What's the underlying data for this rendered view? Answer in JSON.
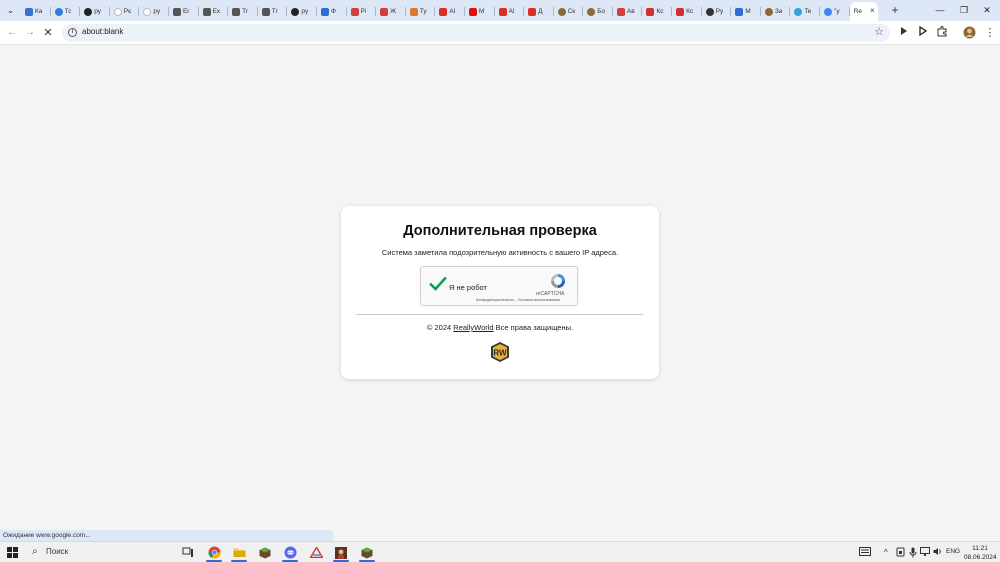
{
  "browser": {
    "tabs": [
      {
        "label": "Ка",
        "icon": "tab-favicon-blue-square",
        "color": "#3b6fd1"
      },
      {
        "label": "Тс",
        "icon": "tab-favicon-blue-circle",
        "color": "#2f7de1"
      },
      {
        "label": "py",
        "icon": "github-icon",
        "color": "#222222"
      },
      {
        "label": "Рє",
        "icon": "tab-favicon-white-circle",
        "color": "#ffffff"
      },
      {
        "label": "py",
        "icon": "tab-favicon-white-circle",
        "color": "#ffffff"
      },
      {
        "label": "Er",
        "icon": "document-icon",
        "color": "#555555"
      },
      {
        "label": "Ex",
        "icon": "document-icon",
        "color": "#555555"
      },
      {
        "label": "Tr",
        "icon": "document-icon",
        "color": "#555555"
      },
      {
        "label": "Tr",
        "icon": "document-icon",
        "color": "#555555"
      },
      {
        "label": "py",
        "icon": "github-icon",
        "color": "#222222"
      },
      {
        "label": "Ф",
        "icon": "tab-favicon-blue-square",
        "color": "#2f6fd1"
      },
      {
        "label": "Pi",
        "icon": "tab-favicon-red-triangle",
        "color": "#d04040"
      },
      {
        "label": "Ж",
        "icon": "tab-favicon-red-triangle",
        "color": "#d04040"
      },
      {
        "label": "Ту",
        "icon": "tab-favicon-orange-square",
        "color": "#e07a28"
      },
      {
        "label": "Al",
        "icon": "gmail-icon",
        "color": "#d93025"
      },
      {
        "label": "M",
        "icon": "tab-favicon-red-square",
        "color": "#e01010"
      },
      {
        "label": "Al",
        "icon": "gmail-icon",
        "color": "#d93025"
      },
      {
        "label": "Д",
        "icon": "gmail-icon",
        "color": "#d93025"
      },
      {
        "label": "Ск",
        "icon": "tab-favicon-brown-circle",
        "color": "#8a6a3a"
      },
      {
        "label": "Бо",
        "icon": "tab-favicon-brown-circle",
        "color": "#8a6a3a"
      },
      {
        "label": "Ав",
        "icon": "tab-favicon-red-triangle",
        "color": "#d04040"
      },
      {
        "label": "Кс",
        "icon": "car-icon",
        "color": "#d03030"
      },
      {
        "label": "Кс",
        "icon": "car-icon",
        "color": "#d03030"
      },
      {
        "label": "Ру",
        "icon": "tab-favicon-dark-circle",
        "color": "#333333"
      },
      {
        "label": "M",
        "icon": "tab-favicon-blue-square",
        "color": "#2f6fd1"
      },
      {
        "label": "За",
        "icon": "tab-favicon-brown-circle",
        "color": "#8a6a3a"
      },
      {
        "label": "Te",
        "icon": "telegram-icon",
        "color": "#2aa3e0"
      },
      {
        "label": "\"у",
        "icon": "google-icon",
        "color": "#4285f4"
      }
    ],
    "active_tab": {
      "label": "Re",
      "close_glyph": "×"
    },
    "new_tab_glyph": "+",
    "window_controls": {
      "minimize": "—",
      "restore": "❐",
      "close": "✕"
    },
    "url": "about:blank"
  },
  "page": {
    "title": "Дополнительная проверка",
    "subtitle": "Система заметила подозрительную активность с вашего IP адреса.",
    "captcha": {
      "label": "Я не робот",
      "brand": "reCAPTCHA",
      "links": "Конфиденциальность - Условия использования",
      "checked": true
    },
    "footer": {
      "prefix": "© 2024 ",
      "link": "ReallyWorld",
      "suffix": " Все права защищены."
    },
    "logo_text": "RW"
  },
  "status_bar": {
    "text": "Ожидание www.google.com..."
  },
  "taskbar": {
    "search_placeholder": "Поиск",
    "apps": [
      {
        "name": "chrome",
        "active": true
      },
      {
        "name": "file-explorer",
        "active": true
      },
      {
        "name": "minecraft",
        "active": false
      },
      {
        "name": "discord",
        "active": true
      },
      {
        "name": "app-red-triangle",
        "active": false
      },
      {
        "name": "app-character",
        "active": true
      },
      {
        "name": "minecraft-2",
        "active": true
      }
    ],
    "language": "ENG",
    "time": "11:21",
    "date": "08.06.2024"
  },
  "colors": {
    "accent": "#2f6fd1",
    "check": "#0f9d58",
    "tab_bar": "#dee7f6"
  }
}
